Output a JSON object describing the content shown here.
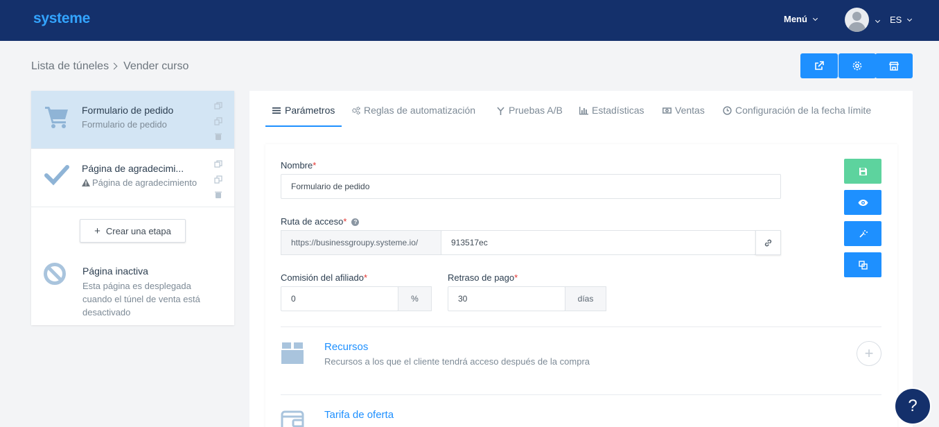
{
  "header": {
    "logo": "systeme",
    "menu_label": "Menú",
    "language": "ES"
  },
  "breadcrumb": {
    "items": [
      "Lista de túneles",
      "Vender curso"
    ]
  },
  "toolbar": {
    "buttons": [
      "external-link-icon",
      "gear-icon",
      "shop-icon"
    ],
    "accent": "#1e90ff"
  },
  "steps": {
    "items": [
      {
        "title": "Formulario de pedido",
        "subtitle": "Formulario de pedido",
        "icon": "cart-icon"
      },
      {
        "title": "Página de agradecimi...",
        "subtitle": "Página de agradecimiento",
        "icon": "check-icon"
      }
    ],
    "create_label": "Crear una etapa",
    "inactive": {
      "title": "Página inactiva",
      "description": "Esta página es desplegada cuando el túnel de venta está desactivado"
    }
  },
  "tabs": [
    {
      "label": "Parámetros",
      "icon": "list-icon"
    },
    {
      "label": "Reglas de automatización",
      "icon": "gears-icon"
    },
    {
      "label": "Pruebas A/B",
      "icon": "split-icon"
    },
    {
      "label": "Estadísticas",
      "icon": "bar-chart-icon"
    },
    {
      "label": "Ventas",
      "icon": "money-icon"
    },
    {
      "label": "Configuración de la fecha límite",
      "icon": "clock-icon"
    }
  ],
  "form": {
    "name_label": "Nombre",
    "name_value": "Formulario de pedido",
    "path_label": "Ruta de acceso",
    "path_prefix": "https://businessgroupy.systeme.io/",
    "path_value": "913517ec",
    "commission_label": "Comisión del afiliado",
    "commission_value": "0",
    "commission_unit": "%",
    "delay_label": "Retraso de pago",
    "delay_value": "30",
    "delay_unit": "días",
    "required_mark": "*"
  },
  "side_actions": {
    "save_color": "#5dd39e",
    "primary_color": "#1e90ff"
  },
  "sections": [
    {
      "title": "Recursos",
      "description": "Recursos a los que el cliente tendrá acceso después de la compra"
    },
    {
      "title": "Tarifa de oferta",
      "description": ""
    }
  ],
  "help_label": "?"
}
